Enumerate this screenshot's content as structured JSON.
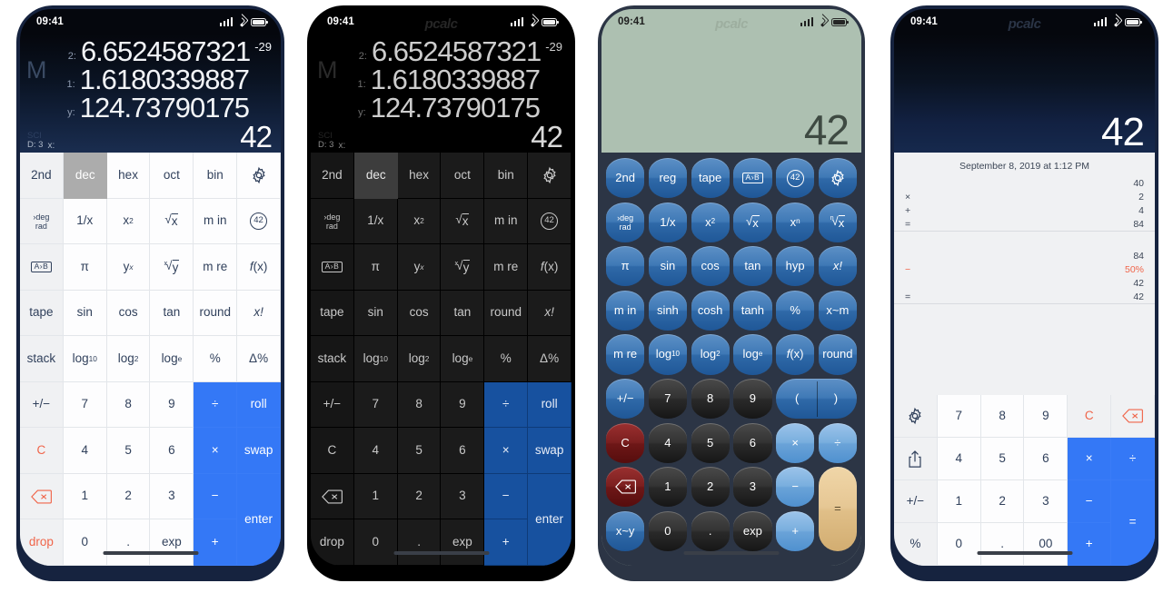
{
  "app": {
    "watermark": "pcalc",
    "background": "#ffffff",
    "accent_blue": "#3478f6",
    "dark_blue": "#17519f",
    "red": "#f0654a",
    "teal_display": "#adc0b1"
  },
  "status_bar": {
    "time": "09:41",
    "icons": [
      "signal-bars",
      "wifi",
      "battery"
    ]
  },
  "devices": [
    {
      "id": "phone-light-rpn",
      "theme": "light",
      "display": {
        "memory_indicator": "M",
        "stack": [
          {
            "label": "2:",
            "value": "6.6524587321",
            "exponent": "-29"
          },
          {
            "label": "1:",
            "value": "1.6180339887",
            "exponent": ""
          },
          {
            "label": "y:",
            "value": "124.73790175",
            "exponent": ""
          }
        ],
        "mode_sci": "SCI",
        "mode_digits": "D: 3",
        "x_label": "x:",
        "x_value": "42"
      },
      "keys": [
        [
          {
            "t": "2nd",
            "s": "gray"
          },
          {
            "t": "dec",
            "s": "sel"
          },
          {
            "t": "hex",
            "s": "white"
          },
          {
            "t": "oct",
            "s": "white"
          },
          {
            "t": "bin",
            "s": "white"
          },
          {
            "t": "gear-icon",
            "s": "white",
            "icon": "gear"
          }
        ],
        [
          {
            "t": "deg rad",
            "s": "gray",
            "icon": "degrad"
          },
          {
            "t": "1/x",
            "s": "white"
          },
          {
            "t": "x2",
            "s": "white",
            "icon": "x2"
          },
          {
            "t": "sqrtx",
            "s": "white",
            "icon": "sqrtx"
          },
          {
            "t": "m in",
            "s": "white"
          },
          {
            "t": "42-icon",
            "s": "white",
            "icon": "c42"
          }
        ],
        [
          {
            "t": "A>B",
            "s": "gray",
            "icon": "ab"
          },
          {
            "t": "π",
            "s": "white"
          },
          {
            "t": "yx",
            "s": "white",
            "icon": "yx"
          },
          {
            "t": "xrooty",
            "s": "white",
            "icon": "xrooty"
          },
          {
            "t": "m re",
            "s": "white"
          },
          {
            "t": "f(x)",
            "s": "white",
            "icon": "fx"
          }
        ],
        [
          {
            "t": "tape",
            "s": "gray"
          },
          {
            "t": "sin",
            "s": "white"
          },
          {
            "t": "cos",
            "s": "white"
          },
          {
            "t": "tan",
            "s": "white"
          },
          {
            "t": "round",
            "s": "white"
          },
          {
            "t": "x!",
            "s": "white",
            "icon": "xfact"
          }
        ],
        [
          {
            "t": "stack",
            "s": "gray"
          },
          {
            "t": "log10",
            "s": "white",
            "icon": "log10"
          },
          {
            "t": "log2",
            "s": "white",
            "icon": "log2"
          },
          {
            "t": "loge",
            "s": "white",
            "icon": "loge"
          },
          {
            "t": "%",
            "s": "white"
          },
          {
            "t": "Δ%",
            "s": "white"
          }
        ],
        [
          {
            "t": "+/−",
            "s": "gray"
          },
          {
            "t": "7",
            "s": "white"
          },
          {
            "t": "8",
            "s": "white"
          },
          {
            "t": "9",
            "s": "white"
          },
          {
            "t": "÷",
            "s": "blue"
          },
          {
            "t": "roll",
            "s": "blue"
          }
        ],
        [
          {
            "t": "C",
            "s": "gray red"
          },
          {
            "t": "4",
            "s": "white"
          },
          {
            "t": "5",
            "s": "white"
          },
          {
            "t": "6",
            "s": "white"
          },
          {
            "t": "×",
            "s": "blue"
          },
          {
            "t": "swap",
            "s": "blue"
          }
        ],
        [
          {
            "t": "backspace-icon",
            "s": "gray red",
            "icon": "bksp"
          },
          {
            "t": "1",
            "s": "white"
          },
          {
            "t": "2",
            "s": "white"
          },
          {
            "t": "3",
            "s": "white"
          },
          {
            "t": "−",
            "s": "blue"
          },
          {
            "t": "enter",
            "s": "blue",
            "span": 2
          }
        ],
        [
          {
            "t": "drop",
            "s": "gray red"
          },
          {
            "t": "0",
            "s": "white"
          },
          {
            "t": ".",
            "s": "white"
          },
          {
            "t": "exp",
            "s": "white"
          },
          {
            "t": "+",
            "s": "blue"
          }
        ]
      ]
    },
    {
      "id": "phone-dark-rpn",
      "theme": "dark",
      "display": {
        "memory_indicator": "M",
        "stack": [
          {
            "label": "2:",
            "value": "6.6524587321",
            "exponent": "-29"
          },
          {
            "label": "1:",
            "value": "1.6180339887",
            "exponent": ""
          },
          {
            "label": "y:",
            "value": "124.73790175",
            "exponent": ""
          }
        ],
        "mode_sci": "SCI",
        "mode_digits": "D: 3",
        "x_label": "x:",
        "x_value": "42"
      },
      "keys": [
        [
          {
            "t": "2nd",
            "s": "gray"
          },
          {
            "t": "dec",
            "s": "sel"
          },
          {
            "t": "hex",
            "s": "white"
          },
          {
            "t": "oct",
            "s": "white"
          },
          {
            "t": "bin",
            "s": "white"
          },
          {
            "t": "gear-icon",
            "s": "white",
            "icon": "gear"
          }
        ],
        [
          {
            "t": "deg rad",
            "s": "gray",
            "icon": "degrad"
          },
          {
            "t": "1/x",
            "s": "white"
          },
          {
            "t": "x2",
            "s": "white",
            "icon": "x2"
          },
          {
            "t": "sqrtx",
            "s": "white",
            "icon": "sqrtx"
          },
          {
            "t": "m in",
            "s": "white"
          },
          {
            "t": "42-icon",
            "s": "white",
            "icon": "c42"
          }
        ],
        [
          {
            "t": "A>B",
            "s": "gray",
            "icon": "ab"
          },
          {
            "t": "π",
            "s": "white"
          },
          {
            "t": "yx",
            "s": "white",
            "icon": "yx"
          },
          {
            "t": "xrooty",
            "s": "white",
            "icon": "xrooty"
          },
          {
            "t": "m re",
            "s": "white"
          },
          {
            "t": "f(x)",
            "s": "white",
            "icon": "fx"
          }
        ],
        [
          {
            "t": "tape",
            "s": "gray"
          },
          {
            "t": "sin",
            "s": "white"
          },
          {
            "t": "cos",
            "s": "white"
          },
          {
            "t": "tan",
            "s": "white"
          },
          {
            "t": "round",
            "s": "white"
          },
          {
            "t": "x!",
            "s": "white",
            "icon": "xfact"
          }
        ],
        [
          {
            "t": "stack",
            "s": "gray"
          },
          {
            "t": "log10",
            "s": "white",
            "icon": "log10"
          },
          {
            "t": "log2",
            "s": "white",
            "icon": "log2"
          },
          {
            "t": "loge",
            "s": "white",
            "icon": "loge"
          },
          {
            "t": "%",
            "s": "white"
          },
          {
            "t": "Δ%",
            "s": "white"
          }
        ],
        [
          {
            "t": "+/−",
            "s": "gray"
          },
          {
            "t": "7",
            "s": "white"
          },
          {
            "t": "8",
            "s": "white"
          },
          {
            "t": "9",
            "s": "white"
          },
          {
            "t": "÷",
            "s": "blue"
          },
          {
            "t": "roll",
            "s": "blue"
          }
        ],
        [
          {
            "t": "C",
            "s": "gray"
          },
          {
            "t": "4",
            "s": "white"
          },
          {
            "t": "5",
            "s": "white"
          },
          {
            "t": "6",
            "s": "white"
          },
          {
            "t": "×",
            "s": "blue"
          },
          {
            "t": "swap",
            "s": "blue"
          }
        ],
        [
          {
            "t": "backspace-icon",
            "s": "gray",
            "icon": "bksp"
          },
          {
            "t": "1",
            "s": "white"
          },
          {
            "t": "2",
            "s": "white"
          },
          {
            "t": "3",
            "s": "white"
          },
          {
            "t": "−",
            "s": "blue"
          },
          {
            "t": "enter",
            "s": "blue",
            "span": 2
          }
        ],
        [
          {
            "t": "drop",
            "s": "gray"
          },
          {
            "t": "0",
            "s": "white"
          },
          {
            "t": ".",
            "s": "white"
          },
          {
            "t": "exp",
            "s": "white"
          },
          {
            "t": "+",
            "s": "blue"
          }
        ]
      ]
    },
    {
      "id": "phone-retro-round",
      "theme": "retro",
      "display": {
        "value": "42"
      },
      "keys": [
        [
          {
            "t": "2nd",
            "s": "blue"
          },
          {
            "t": "reg",
            "s": "blue"
          },
          {
            "t": "tape",
            "s": "blue"
          },
          {
            "t": "A>B",
            "s": "blue",
            "icon": "ab"
          },
          {
            "t": "42-icon",
            "s": "blue",
            "icon": "c42"
          },
          {
            "t": "gear-icon",
            "s": "blue",
            "icon": "gear"
          }
        ],
        [
          {
            "t": "deg rad",
            "s": "blue",
            "icon": "degrad"
          },
          {
            "t": "1/x",
            "s": "blue"
          },
          {
            "t": "x2",
            "s": "blue",
            "icon": "x2"
          },
          {
            "t": "sqrtx",
            "s": "blue",
            "icon": "sqrtx"
          },
          {
            "t": "xn",
            "s": "blue",
            "icon": "xn"
          },
          {
            "t": "nrootx",
            "s": "blue",
            "icon": "nrootx"
          }
        ],
        [
          {
            "t": "π",
            "s": "blue"
          },
          {
            "t": "sin",
            "s": "blue"
          },
          {
            "t": "cos",
            "s": "blue"
          },
          {
            "t": "tan",
            "s": "blue"
          },
          {
            "t": "hyp",
            "s": "blue"
          },
          {
            "t": "x!",
            "s": "blue",
            "icon": "xfact"
          }
        ],
        [
          {
            "t": "m in",
            "s": "blue"
          },
          {
            "t": "sinh",
            "s": "blue"
          },
          {
            "t": "cosh",
            "s": "blue"
          },
          {
            "t": "tanh",
            "s": "blue"
          },
          {
            "t": "%",
            "s": "blue"
          },
          {
            "t": "x~m",
            "s": "blue"
          }
        ],
        [
          {
            "t": "m re",
            "s": "blue"
          },
          {
            "t": "log10",
            "s": "blue",
            "icon": "log10"
          },
          {
            "t": "log2",
            "s": "blue",
            "icon": "log2"
          },
          {
            "t": "loge",
            "s": "blue",
            "icon": "loge"
          },
          {
            "t": "f(x)",
            "s": "blue",
            "icon": "fx"
          },
          {
            "t": "round",
            "s": "blue"
          }
        ],
        [
          {
            "t": "+/−",
            "s": "blue"
          },
          {
            "t": "7",
            "s": "dark"
          },
          {
            "t": "8",
            "s": "dark"
          },
          {
            "t": "9",
            "s": "dark"
          },
          {
            "t": "( )",
            "s": "paren",
            "span": 2
          }
        ],
        [
          {
            "t": "C",
            "s": "red"
          },
          {
            "t": "4",
            "s": "dark"
          },
          {
            "t": "5",
            "s": "dark"
          },
          {
            "t": "6",
            "s": "dark"
          },
          {
            "t": "×",
            "s": "lblue"
          },
          {
            "t": "÷",
            "s": "lblue"
          }
        ],
        [
          {
            "t": "backspace-icon",
            "s": "red",
            "icon": "bksp"
          },
          {
            "t": "1",
            "s": "dark"
          },
          {
            "t": "2",
            "s": "dark"
          },
          {
            "t": "3",
            "s": "dark"
          },
          {
            "t": "−",
            "s": "lblue"
          },
          {
            "t": "=",
            "s": "tan",
            "rowspan": 2
          }
        ],
        [
          {
            "t": "x~y",
            "s": "blue"
          },
          {
            "t": "0",
            "s": "dark"
          },
          {
            "t": ".",
            "s": "dark"
          },
          {
            "t": "exp",
            "s": "dark"
          },
          {
            "t": "+",
            "s": "lblue"
          }
        ]
      ]
    },
    {
      "id": "phone-tape-basic",
      "theme": "light-tape",
      "display": {
        "value": "42"
      },
      "tape": {
        "date": "September 8, 2019 at 1:12 PM",
        "entries": [
          {
            "op": "",
            "value": "40",
            "rule": false,
            "red": false
          },
          {
            "op": "×",
            "value": "2",
            "rule": false,
            "red": false
          },
          {
            "op": "+",
            "value": "4",
            "rule": false,
            "red": false
          },
          {
            "op": "=",
            "value": "84",
            "rule": true,
            "red": false
          },
          {
            "gap": true
          },
          {
            "op": "",
            "value": "84",
            "rule": false,
            "red": false
          },
          {
            "op": "−",
            "value": "50%",
            "rule": false,
            "red": true
          },
          {
            "op": "",
            "value": "42",
            "rule": false,
            "red": false
          },
          {
            "op": "=",
            "value": "42",
            "rule": true,
            "red": false
          }
        ]
      },
      "keys": [
        [
          {
            "t": "gear-icon",
            "s": "gray",
            "icon": "gear"
          },
          {
            "t": "7",
            "s": "white"
          },
          {
            "t": "8",
            "s": "white"
          },
          {
            "t": "9",
            "s": "white"
          },
          {
            "t": "C",
            "s": "gray red"
          },
          {
            "t": "backspace-icon",
            "s": "gray red",
            "icon": "bksp"
          }
        ],
        [
          {
            "t": "share-icon",
            "s": "gray",
            "icon": "share"
          },
          {
            "t": "4",
            "s": "white"
          },
          {
            "t": "5",
            "s": "white"
          },
          {
            "t": "6",
            "s": "white"
          },
          {
            "t": "×",
            "s": "blue"
          },
          {
            "t": "÷",
            "s": "blue"
          }
        ],
        [
          {
            "t": "+/−",
            "s": "gray"
          },
          {
            "t": "1",
            "s": "white"
          },
          {
            "t": "2",
            "s": "white"
          },
          {
            "t": "3",
            "s": "white"
          },
          {
            "t": "−",
            "s": "blue"
          },
          {
            "t": "=",
            "s": "blue",
            "span": 2
          }
        ],
        [
          {
            "t": "%",
            "s": "gray"
          },
          {
            "t": "0",
            "s": "white"
          },
          {
            "t": ".",
            "s": "white"
          },
          {
            "t": "00",
            "s": "white"
          },
          {
            "t": "+",
            "s": "blue"
          }
        ]
      ]
    }
  ]
}
